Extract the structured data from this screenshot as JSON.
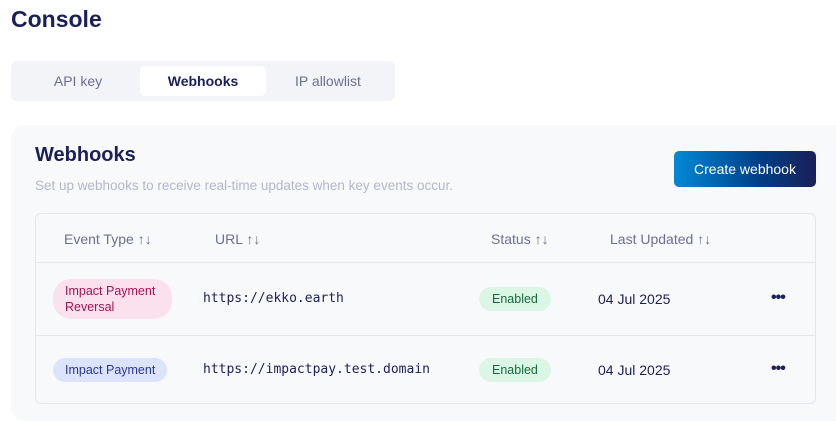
{
  "page": {
    "title": "Console"
  },
  "tabs": [
    {
      "label": "API key"
    },
    {
      "label": "Webhooks",
      "active": true
    },
    {
      "label": "IP allowlist"
    }
  ],
  "webhooks": {
    "title": "Webhooks",
    "description": "Set up webhooks to receive real-time updates when key events occur.",
    "create_label": "Create webhook",
    "sort_icon": "↑↓",
    "columns": [
      "Event Type",
      "URL",
      "Status",
      "Last Updated"
    ],
    "rows": [
      {
        "event_type": "Impact Payment Reversal",
        "url": "https://ekko.earth",
        "status": "Enabled",
        "last_updated": "04 Jul 2025",
        "menu": "•••"
      },
      {
        "event_type": "Impact Payment",
        "url": "https://impactpay.test.domain",
        "status": "Enabled",
        "last_updated": "04 Jul 2025",
        "menu": "•••"
      }
    ]
  }
}
